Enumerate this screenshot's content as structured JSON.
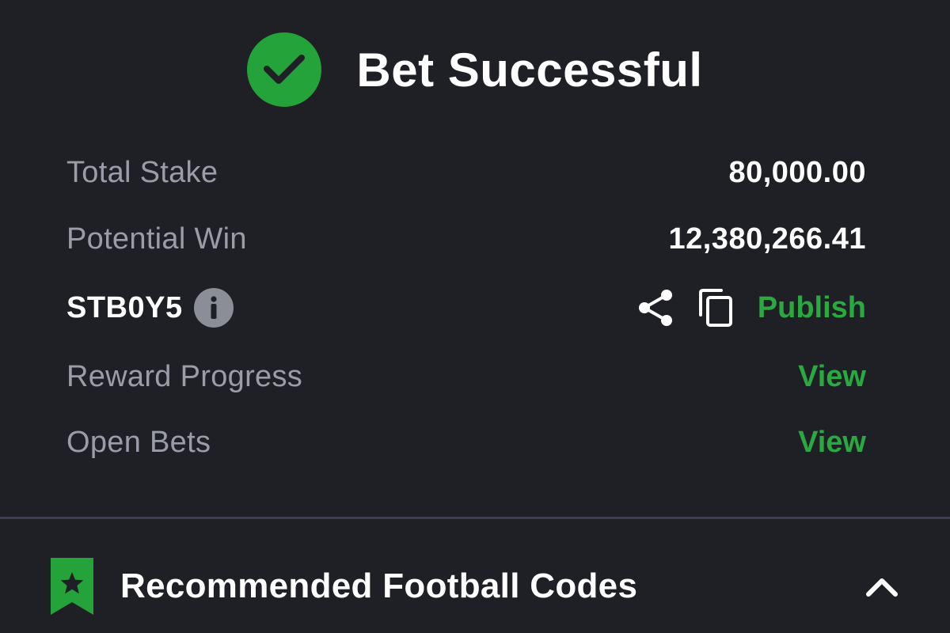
{
  "header": {
    "title": "Bet Successful",
    "icon": "check-circle-icon",
    "icon_color": "#24a33a"
  },
  "summary": {
    "total_stake": {
      "label": "Total Stake",
      "value": "80,000.00"
    },
    "potential_win": {
      "label": "Potential Win",
      "value": "12,380,266.41"
    }
  },
  "booking": {
    "code": "STB0Y5",
    "info_icon": "info-icon",
    "share_icon": "share-icon",
    "copy_icon": "copy-icon",
    "publish_label": "Publish"
  },
  "links": {
    "reward_progress": {
      "label": "Reward Progress",
      "action": "View"
    },
    "open_bets": {
      "label": "Open Bets",
      "action": "View"
    }
  },
  "footer": {
    "title": "Recommended Football Codes",
    "icon": "bookmark-star-icon",
    "toggle_icon": "chevron-up-icon"
  },
  "colors": {
    "background": "#1f2026",
    "accent_green": "#29a93f",
    "label_gray": "#9a9ca8",
    "divider": "#3d4052"
  }
}
